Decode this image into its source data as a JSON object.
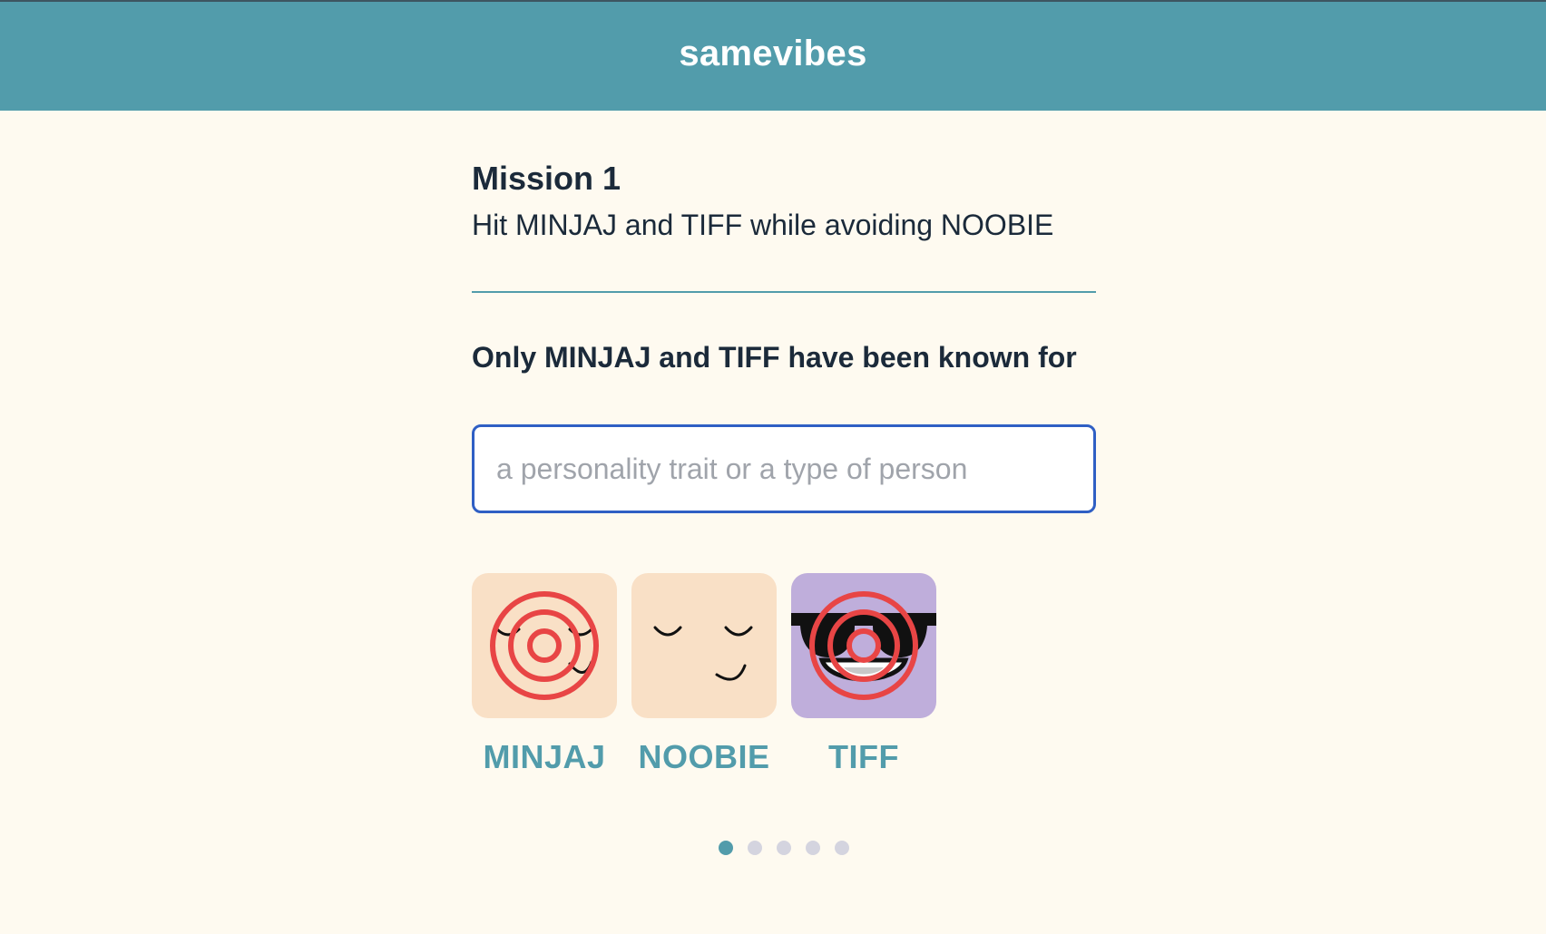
{
  "header": {
    "title": "samevibes"
  },
  "mission": {
    "title": "Mission 1",
    "description": "Hit MINJAJ and TIFF while avoiding NOOBIE"
  },
  "prompt": {
    "text": "Only MINJAJ and TIFF have been known for"
  },
  "answer_input": {
    "value": "",
    "placeholder": "a personality trait or a type of person"
  },
  "characters": [
    {
      "name": "MINJAJ",
      "targeted": true,
      "avatar_color": "#f9e0c6",
      "icon": "sleepy-face-icon"
    },
    {
      "name": "NOOBIE",
      "targeted": false,
      "avatar_color": "#f9e0c6",
      "icon": "sleepy-face-icon"
    },
    {
      "name": "TIFF",
      "targeted": true,
      "avatar_color": "#bfaedb",
      "icon": "sunglasses-face-icon"
    }
  ],
  "pagination": {
    "total": 5,
    "current": 1
  },
  "colors": {
    "header_bg": "#529cab",
    "page_bg": "#fefaf0",
    "accent": "#529cab",
    "input_border": "#2f5fc4",
    "target_red": "#e84545",
    "dot_inactive": "#d4d4df"
  }
}
